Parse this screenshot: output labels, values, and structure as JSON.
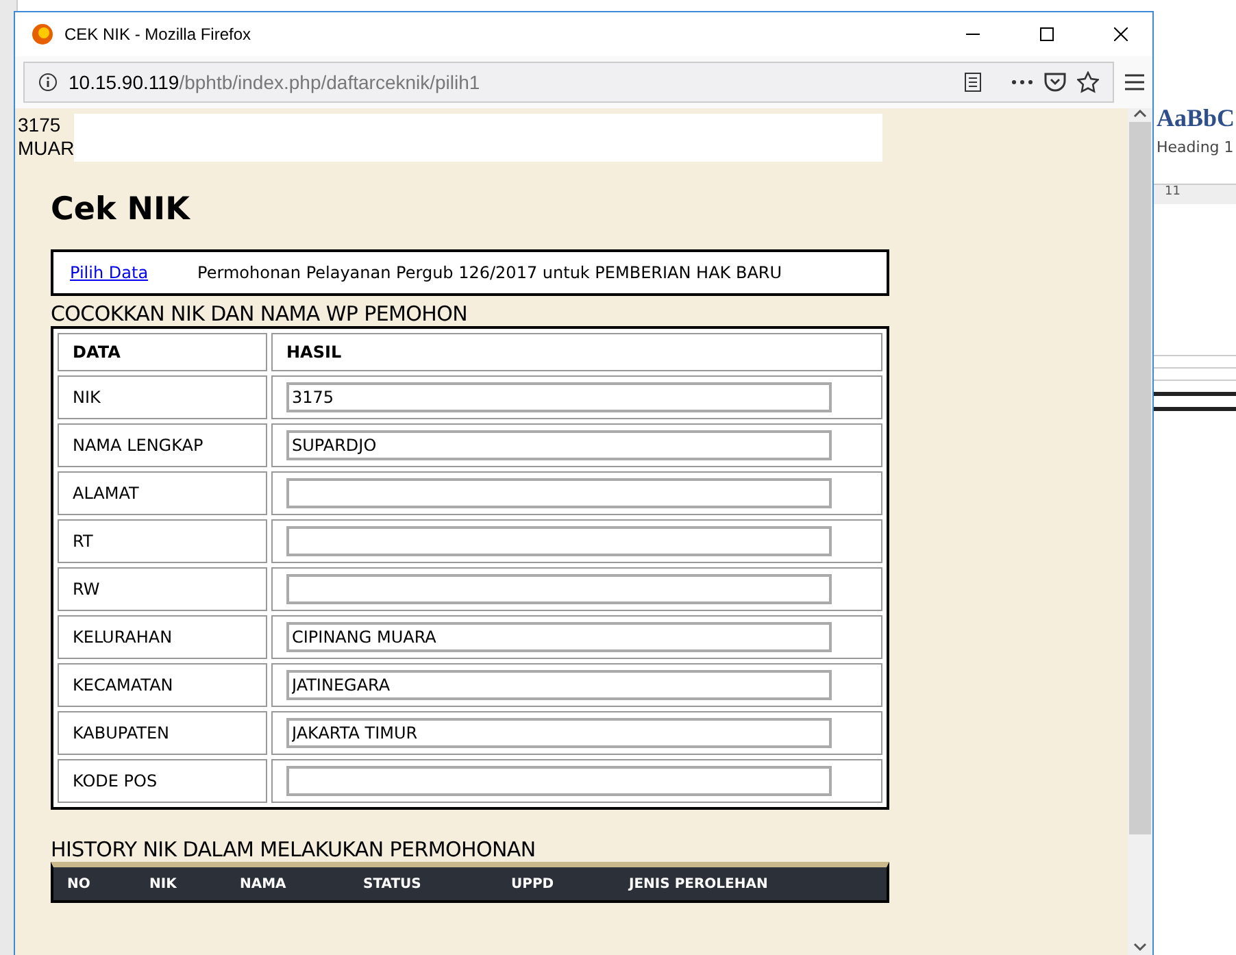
{
  "window": {
    "title": "CEK NIK - Mozilla Firefox"
  },
  "address_bar": {
    "host": "10.15.90.119",
    "path": "/bphtb/index.php/daftarceknik/pilih1"
  },
  "top_text": [
    "3175",
    "MUAR"
  ],
  "page_title": "Cek NIK",
  "info_box": {
    "link": "Pilih Data",
    "text": "Permohonan Pelayanan Pergub 126/2017 untuk PEMBERIAN HAK BARU"
  },
  "match_section": {
    "heading": "COCOKKAN NIK DAN NAMA WP PEMOHON",
    "columns": [
      "DATA",
      "HASIL"
    ],
    "rows": [
      {
        "label": "NIK",
        "value": "3175"
      },
      {
        "label": "NAMA LENGKAP",
        "value": "SUPARDJO"
      },
      {
        "label": "ALAMAT",
        "value": ""
      },
      {
        "label": "RT",
        "value": ""
      },
      {
        "label": "RW",
        "value": ""
      },
      {
        "label": "KELURAHAN",
        "value": "CIPINANG MUARA"
      },
      {
        "label": "KECAMATAN",
        "value": "JATINEGARA"
      },
      {
        "label": "KABUPATEN",
        "value": "JAKARTA TIMUR"
      },
      {
        "label": "KODE POS",
        "value": ""
      }
    ]
  },
  "history_section": {
    "heading": "HISTORY NIK DALAM MELAKUKAN PERMOHONAN",
    "columns": [
      "NO",
      "NIK",
      "NAMA",
      "STATUS",
      "UPPD",
      "JENIS PEROLEHAN"
    ]
  },
  "background_app": {
    "style_sample": "AaBbC",
    "style_name": "Heading 1",
    "ruler_mark": "11"
  }
}
